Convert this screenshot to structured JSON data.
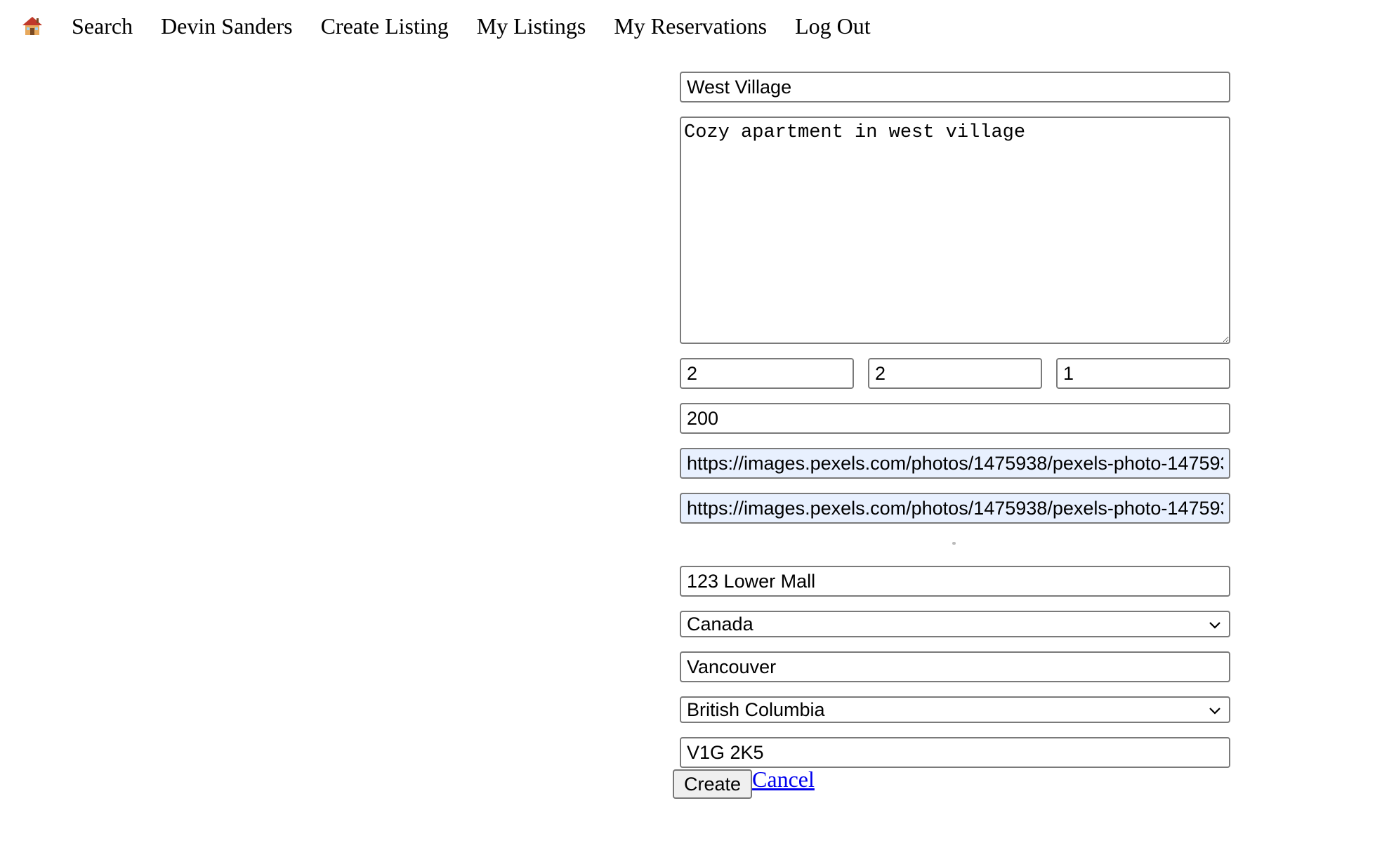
{
  "nav": {
    "home_icon": "house-icon",
    "links": [
      "Search",
      "Devin Sanders",
      "Create Listing",
      "My Listings",
      "My Reservations",
      "Log Out"
    ]
  },
  "form": {
    "title_value": "West Village",
    "description_value": "Cozy apartment in west village",
    "counts": [
      "2",
      "2",
      "1"
    ],
    "price_value": "200",
    "image_url_1": "https://images.pexels.com/photos/1475938/pexels-photo-147593",
    "image_url_2": "https://images.pexels.com/photos/1475938/pexels-photo-147593",
    "address_value": "123 Lower Mall",
    "country_selected": "Canada",
    "city_value": "Vancouver",
    "state_selected": "British Columbia",
    "postal_value": "V1G 2K5"
  },
  "actions": {
    "create_label": "Create",
    "cancel_label": "Cancel"
  },
  "colors": {
    "link": "#0000ee",
    "autofill_bg": "#e8f0fe",
    "border": "#7a7a7a"
  }
}
